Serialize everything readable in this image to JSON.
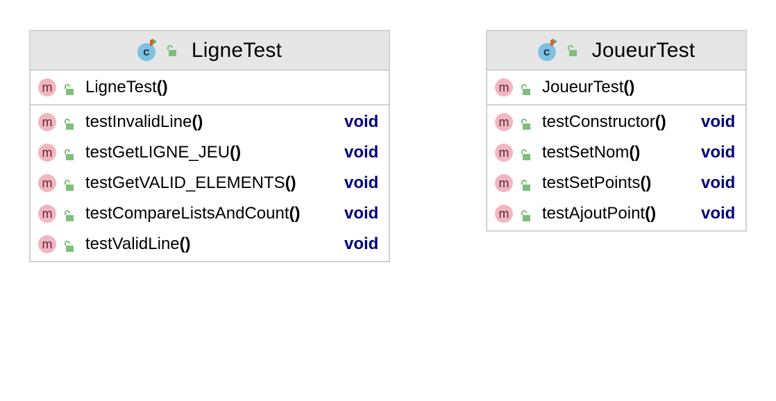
{
  "classes": [
    {
      "name": "LigneTest",
      "constructor": {
        "name": "LigneTest",
        "parens": "()"
      },
      "methods": [
        {
          "name": "testInvalidLine",
          "parens": "()",
          "returns": "void"
        },
        {
          "name": "testGetLIGNE_JEU",
          "parens": "()",
          "returns": "void"
        },
        {
          "name": "testGetVALID_ELEMENTS",
          "parens": "()",
          "returns": "void"
        },
        {
          "name": "testCompareListsAndCount",
          "parens": "()",
          "returns": "void"
        },
        {
          "name": "testValidLine",
          "parens": "()",
          "returns": "void"
        }
      ]
    },
    {
      "name": "JoueurTest",
      "constructor": {
        "name": "JoueurTest",
        "parens": "()"
      },
      "methods": [
        {
          "name": "testConstructor",
          "parens": "()",
          "returns": "void"
        },
        {
          "name": "testSetNom",
          "parens": "()",
          "returns": "void"
        },
        {
          "name": "testSetPoints",
          "parens": "()",
          "returns": "void"
        },
        {
          "name": "testAjoutPoint",
          "parens": "()",
          "returns": "void"
        }
      ]
    }
  ],
  "icons": {
    "class_icon": "class-icon",
    "class_icon_letter": "c",
    "method_icon": "method-icon",
    "method_icon_letter": "m",
    "visibility_icon": "public-lock-icon"
  },
  "colors": {
    "header_bg": "#e6e6e6",
    "border": "#d2d2d2",
    "class_icon": "#7fc1e2",
    "method_icon": "#f2b6c2",
    "lock_icon": "#7cc07a",
    "return_type": "#000080"
  }
}
